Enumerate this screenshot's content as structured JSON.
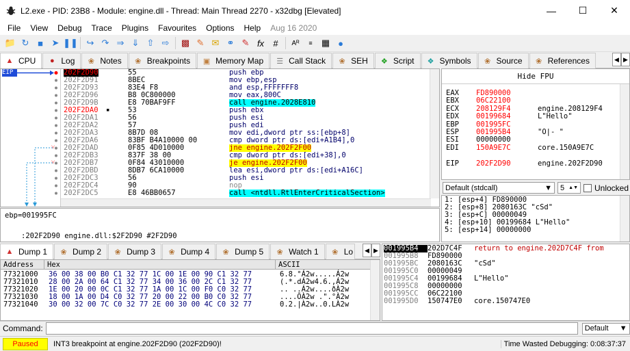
{
  "window": {
    "title": "L2.exe - PID: 23B8 - Module: engine.dll - Thread: Main Thread 2270 - x32dbg [Elevated]"
  },
  "menu": [
    "File",
    "View",
    "Debug",
    "Trace",
    "Plugins",
    "Favourites",
    "Options",
    "Help"
  ],
  "menu_date": "Aug 16 2020",
  "tabs": [
    "CPU",
    "Log",
    "Notes",
    "Breakpoints",
    "Memory Map",
    "Call Stack",
    "SEH",
    "Script",
    "Symbols",
    "Source",
    "References"
  ],
  "eip_label": "EIP",
  "disasm": [
    {
      "addr": "202F2D90",
      "bytes": "55",
      "ins": "push ebp",
      "style": "cur"
    },
    {
      "addr": "202F2D91",
      "bytes": "8BEC",
      "ins": "mov ebp,esp"
    },
    {
      "addr": "202F2D93",
      "bytes": "83E4 F8",
      "ins": "and esp,FFFFFFF8"
    },
    {
      "addr": "202F2D96",
      "bytes": "B8 0C800000",
      "ins": "mov eax,800C"
    },
    {
      "addr": "202F2D9B",
      "bytes": "E8 70BAF9FF",
      "ins": "call engine.2028E810",
      "kind": "call"
    },
    {
      "addr": "202F2DA0",
      "bytes": "53",
      "ins": "push ebx",
      "red": true
    },
    {
      "addr": "202F2DA1",
      "bytes": "56",
      "ins": "push esi"
    },
    {
      "addr": "202F2DA2",
      "bytes": "57",
      "ins": "push edi"
    },
    {
      "addr": "202F2DA3",
      "bytes": "8B7D 08",
      "ins": "mov edi,dword ptr ss:[ebp+8]"
    },
    {
      "addr": "202F2DA6",
      "bytes": "83BF B4A10000 00",
      "ins": "cmp dword ptr ds:[edi+A1B4],0"
    },
    {
      "addr": "202F2DAD",
      "bytes": "0F85 4D010000",
      "ins": "jne engine.202F2F00",
      "kind": "jmp",
      "gut": "v"
    },
    {
      "addr": "202F2DB3",
      "bytes": "837F 38 00",
      "ins": "cmp dword ptr ds:[edi+38],0"
    },
    {
      "addr": "202F2DB7",
      "bytes": "0F84 43010000",
      "ins": "je engine.202F2F00",
      "kind": "jmp",
      "gut": "v"
    },
    {
      "addr": "202F2DBD",
      "bytes": "8DB7 6CA10000",
      "ins": "lea esi,dword ptr ds:[edi+A16C]"
    },
    {
      "addr": "202F2DC3",
      "bytes": "56",
      "ins": "push esi"
    },
    {
      "addr": "202F2DC4",
      "bytes": "90",
      "ins": "nop",
      "kind": "nop"
    },
    {
      "addr": "202F2DC5",
      "bytes": "E8 46BB0657",
      "ins": "call <ntdll.RtlEnterCriticalSection>",
      "kind": "call2"
    }
  ],
  "info": {
    "line1": "ebp=001995FC",
    "line2": ":202F2D90 engine.dll:$2F2D90 #2F2D90"
  },
  "fpu_button": "Hide FPU",
  "registers": [
    {
      "n": "EAX",
      "v": "FD890000",
      "c": ""
    },
    {
      "n": "EBX",
      "v": "06C22100",
      "c": ""
    },
    {
      "n": "ECX",
      "v": "208129F4",
      "c": "engine.208129F4"
    },
    {
      "n": "EDX",
      "v": "00199684",
      "c": "L\"Hello\""
    },
    {
      "n": "EBP",
      "v": "001995FC",
      "c": ""
    },
    {
      "n": "ESP",
      "v": "001995B4",
      "c": "\"O|- \""
    },
    {
      "n": "ESI",
      "v": "00000000",
      "c": "",
      "blk": true
    },
    {
      "n": "EDI",
      "v": "150A9E7C",
      "c": "core.150A9E7C"
    },
    {
      "n": "",
      "v": "",
      "c": ""
    },
    {
      "n": "EIP",
      "v": "202F2D90",
      "c": "engine.202F2D90"
    }
  ],
  "callconv": {
    "value": "Default (stdcall)",
    "argc": "5",
    "unlocked": "Unlocked"
  },
  "stackargs": [
    "1: [esp+4] FD890000",
    "2: [esp+8] 2080163C \"cSd\"",
    "3: [esp+C] 00000049",
    "4: [esp+10] 00199684 L\"Hello\"",
    "5: [esp+14] 00000000"
  ],
  "dumptabs": [
    "Dump 1",
    "Dump 2",
    "Dump 3",
    "Dump 4",
    "Dump 5",
    "Watch 1",
    "Lo"
  ],
  "dump_headers": {
    "addr": "Address",
    "hex": "Hex",
    "ascii": "ASCII"
  },
  "dump": [
    {
      "a": "77321000",
      "h": "36 00 38 00  B0 C1 32 77  1C 00 1E 00  90 C1 32 77",
      "s": "6.8.°Á2w.....Á2w"
    },
    {
      "a": "77321010",
      "h": "28 00 2A 00  64 C1 32 77  34 00 36 00  2C C1 32 77",
      "s": "(.*.dÁ2w4.6.,Á2w"
    },
    {
      "a": "77321020",
      "h": "1E 00 20 00  0C C1 32 77  1A 00 1C 00  F0 C0 32 77",
      "s": ".. ..Á2w....ðÀ2w"
    },
    {
      "a": "77321030",
      "h": "18 00 1A 00  D4 C0 32 77  20 00 22 00  B0 C0 32 77",
      "s": "....ÔÀ2w .\".°À2w"
    },
    {
      "a": "77321040",
      "h": "30 00 32 00  7C C0 32 77  2E 00 30 00  4C C0 32 77",
      "s": "0.2.|À2w..0.LÀ2w"
    }
  ],
  "stack": [
    {
      "a": "001995B4",
      "v": "202D7C4F",
      "c": "return to engine.202D7C4F from",
      "cur": true
    },
    {
      "a": "001995B8",
      "v": "FD890000",
      "c": ""
    },
    {
      "a": "001995BC",
      "v": "2080163C",
      "c": "\"cSd\""
    },
    {
      "a": "001995C0",
      "v": "00000049",
      "c": ""
    },
    {
      "a": "001995C4",
      "v": "00199684",
      "c": "L\"Hello\""
    },
    {
      "a": "001995C8",
      "v": "00000000",
      "c": ""
    },
    {
      "a": "001995CC",
      "v": "06C22100",
      "c": ""
    },
    {
      "a": "001995D0",
      "v": "150747E0",
      "c": "core.150747E0"
    }
  ],
  "command": {
    "label": "Command:",
    "default": "Default"
  },
  "status": {
    "state": "Paused",
    "message": "INT3 breakpoint at engine.202F2D90 (202F2D90)!",
    "wasted": "Time Wasted Debugging: 0:08:37:37"
  },
  "colors": {
    "accent": "#1e4bd8",
    "call": "#00ffff",
    "jump": "#ffff00",
    "paused": "#ffff00"
  }
}
